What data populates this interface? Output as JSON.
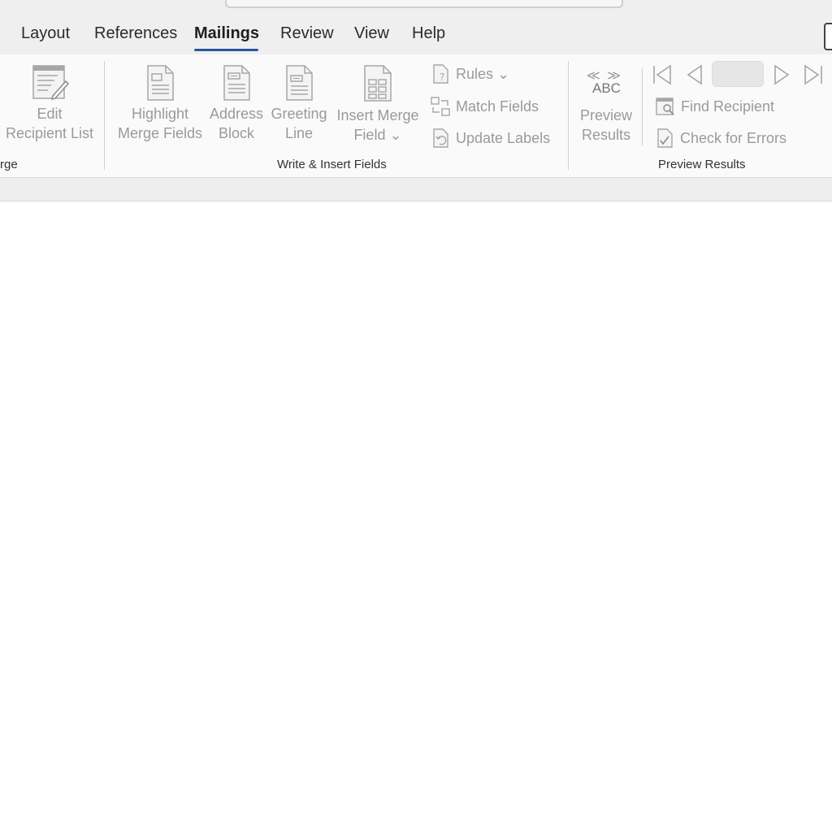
{
  "tabs": {
    "layout": "Layout",
    "references": "References",
    "mailings": "Mailings",
    "review": "Review",
    "view": "View",
    "help": "Help"
  },
  "groups": {
    "start_mail_merge_partial": "rge",
    "write_insert": "Write & Insert Fields",
    "preview_results": "Preview Results"
  },
  "buttons": {
    "edit_recipient_1": "Edit",
    "edit_recipient_2": "Recipient List",
    "highlight_1": "Highlight",
    "highlight_2": "Merge Fields",
    "address_1": "Address",
    "address_2": "Block",
    "greeting_1": "Greeting",
    "greeting_2": "Line",
    "insert_merge_1": "Insert Merge",
    "insert_merge_2": "Field ⌄",
    "rules": "Rules ⌄",
    "match_fields": "Match Fields",
    "update_labels": "Update Labels",
    "preview_1": "Preview",
    "preview_2": "Results",
    "preview_abc": "ABC",
    "preview_arrows": "≪ ≫",
    "find_recipient": "Find Recipient",
    "check_errors": "Check for Errors"
  },
  "preview_record_value": "",
  "colors": {
    "accent": "#2b579a",
    "disabled_text": "#9a9a9a"
  }
}
